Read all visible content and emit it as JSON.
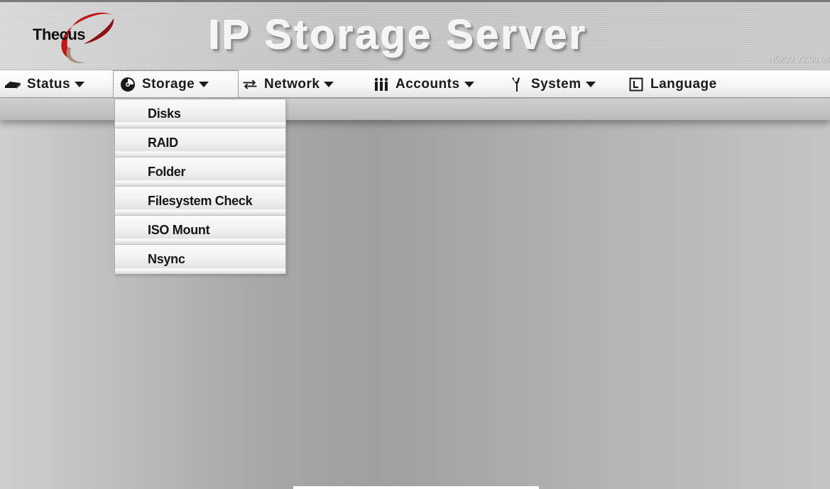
{
  "header": {
    "logo_text": "Thecus",
    "title": "IP Storage Server",
    "version": "N5200 V2.00.08"
  },
  "menu": [
    {
      "label": "Status",
      "icon": "hdd-icon"
    },
    {
      "label": "Storage",
      "icon": "disc-icon"
    },
    {
      "label": "Network",
      "icon": "network-arrows-icon"
    },
    {
      "label": "Accounts",
      "icon": "users-icon"
    },
    {
      "label": "System",
      "icon": "wrench-icon"
    },
    {
      "label": "Language",
      "icon": "language-icon"
    }
  ],
  "storage_dropdown": [
    {
      "label": "Disks"
    },
    {
      "label": "RAID"
    },
    {
      "label": "Folder"
    },
    {
      "label": "Filesystem Check"
    },
    {
      "label": "ISO Mount"
    },
    {
      "label": "Nsync"
    }
  ],
  "colors": {
    "logo_red": "#c0151b",
    "text": "#1a1a1a"
  }
}
